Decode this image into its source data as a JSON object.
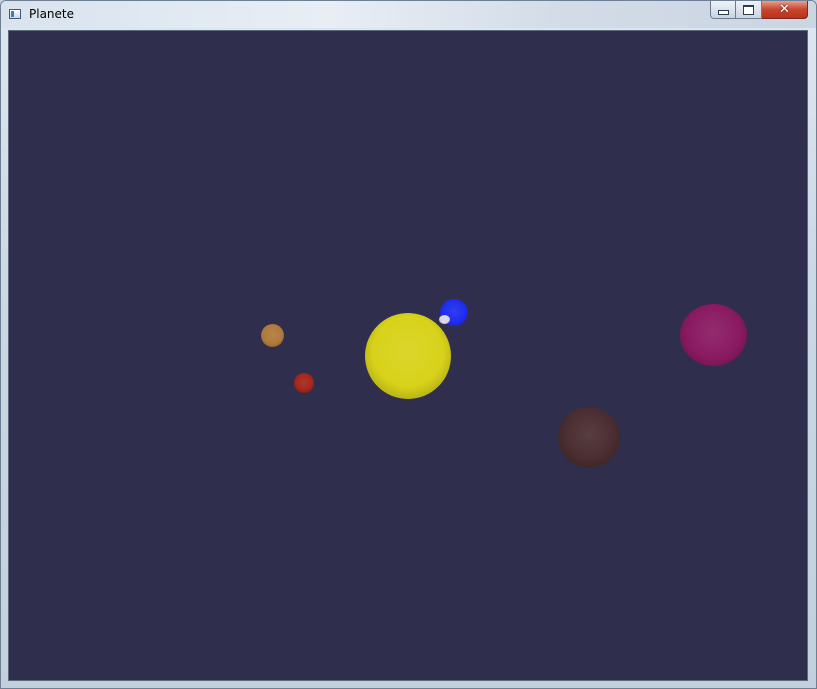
{
  "window": {
    "title": "Planete",
    "icon": "app-window-icon",
    "controls": {
      "minimize_icon": "minimize-icon",
      "maximize_icon": "maximize-icon",
      "close_icon": "close-icon",
      "close_glyph": "✕"
    }
  },
  "scene": {
    "background_color": "#2f2f4d",
    "bodies": [
      {
        "name": "sun",
        "color": "#d8d21a"
      },
      {
        "name": "earth",
        "color": "#1f2cf0"
      },
      {
        "name": "moon",
        "color": "#d7d7e2"
      },
      {
        "name": "mercury",
        "color": "#b07a3c"
      },
      {
        "name": "mars",
        "color": "#a5261c"
      },
      {
        "name": "brown-planet",
        "color": "#4a2d30"
      },
      {
        "name": "magenta-planet",
        "color": "#8a1a62"
      }
    ]
  }
}
